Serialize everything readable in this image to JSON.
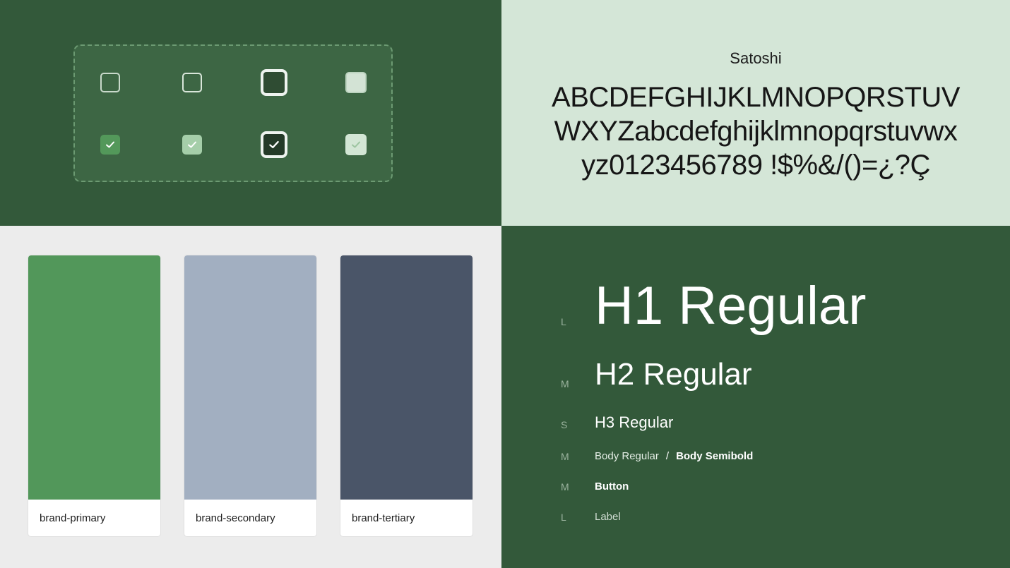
{
  "colors": {
    "dark_green_bg": "#33593a",
    "light_green_bg": "#d4e6d7",
    "neutral_bg": "#ececec"
  },
  "checkboxes": {
    "states": [
      "unchecked",
      "unchecked-hover",
      "unchecked-focus",
      "unchecked-disabled",
      "checked",
      "checked-hover",
      "checked-focus",
      "checked-disabled"
    ]
  },
  "font_specimen": {
    "name": "Satoshi",
    "line1": "ABCDEFGHIJKLMNOPQRSTUV",
    "line2": "WXYZabcdefghijklmnopqrstuvwx",
    "line3": "yz0123456789 !$%&/()=¿?Ç"
  },
  "swatches": [
    {
      "label": "brand-primary",
      "color": "#52975a"
    },
    {
      "label": "brand-secondary",
      "color": "#a2afc1"
    },
    {
      "label": "brand-tertiary",
      "color": "#4a5568"
    }
  ],
  "type_scale": {
    "h1": {
      "size": "L",
      "label": "H1 Regular"
    },
    "h2": {
      "size": "M",
      "label": "H2 Regular"
    },
    "h3": {
      "size": "S",
      "label": "H3 Regular"
    },
    "body": {
      "size": "M",
      "regular": "Body Regular",
      "separator": "/",
      "semibold": "Body Semibold"
    },
    "button": {
      "size": "M",
      "label": "Button"
    },
    "label": {
      "size": "L",
      "label": "Label"
    }
  }
}
